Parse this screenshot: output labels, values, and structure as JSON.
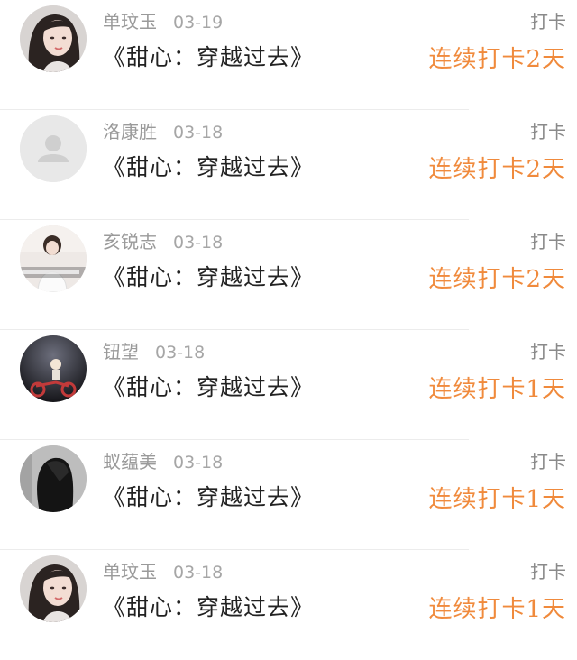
{
  "checkins": [
    {
      "user": "单玟玉",
      "date": "03-19",
      "label": "打卡",
      "book": "《甜心：穿越过去》",
      "streak": "连续打卡2天",
      "avatar_icon": "avatar-photo-woman-long-hair"
    },
    {
      "user": "洛康胜",
      "date": "03-18",
      "label": "打卡",
      "book": "《甜心：穿越过去》",
      "streak": "连续打卡2天",
      "avatar_icon": "avatar-placeholder-person"
    },
    {
      "user": "亥锐志",
      "date": "03-18",
      "label": "打卡",
      "book": "《甜心：穿越过去》",
      "streak": "连续打卡2天",
      "avatar_icon": "avatar-photo-girl-white-dress"
    },
    {
      "user": "钮望",
      "date": "03-18",
      "label": "打卡",
      "book": "《甜心：穿越过去》",
      "streak": "连续打卡1天",
      "avatar_icon": "avatar-photo-child-bicycle"
    },
    {
      "user": "蚁蕴美",
      "date": "03-18",
      "label": "打卡",
      "book": "《甜心：穿越过去》",
      "streak": "连续打卡1天",
      "avatar_icon": "avatar-photo-dark-hair"
    },
    {
      "user": "单玟玉",
      "date": "03-18",
      "label": "打卡",
      "book": "《甜心：穿越过去》",
      "streak": "连续打卡1天",
      "avatar_icon": "avatar-photo-woman-long-hair"
    }
  ],
  "colors": {
    "streak": "#f08a3c",
    "meta": "#9a9a9a",
    "title": "#222222",
    "divider": "#ececec"
  }
}
